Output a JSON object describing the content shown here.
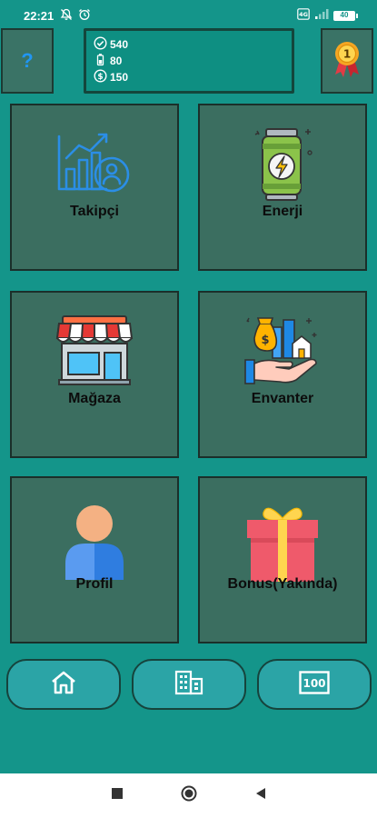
{
  "status_bar": {
    "time": "22:21",
    "battery": "40",
    "icons": [
      "mute-bell-icon",
      "alarm-icon",
      "data-icon",
      "signal-icon",
      "battery-icon"
    ]
  },
  "header": {
    "help_label": "?",
    "stats": {
      "followers": "540",
      "energy": "80",
      "money": "150"
    },
    "medal_number": "1"
  },
  "tiles": [
    {
      "label": "Takipçi",
      "icon": "growth-chart-icon"
    },
    {
      "label": "Enerji",
      "icon": "energy-can-icon"
    },
    {
      "label": "Mağaza",
      "icon": "shop-icon"
    },
    {
      "label": "Envanter",
      "icon": "property-hand-icon"
    },
    {
      "label": "Profil",
      "icon": "user-icon"
    },
    {
      "label": "Bonus(Yakında)",
      "icon": "gift-icon"
    }
  ],
  "bottom_nav": [
    {
      "icon": "home-icon"
    },
    {
      "icon": "building-icon"
    },
    {
      "icon": "hundred-icon",
      "text": "100"
    }
  ],
  "colors": {
    "background": "#14958a",
    "tile": "#3b6e60",
    "nav_button": "#2ba4a6"
  }
}
